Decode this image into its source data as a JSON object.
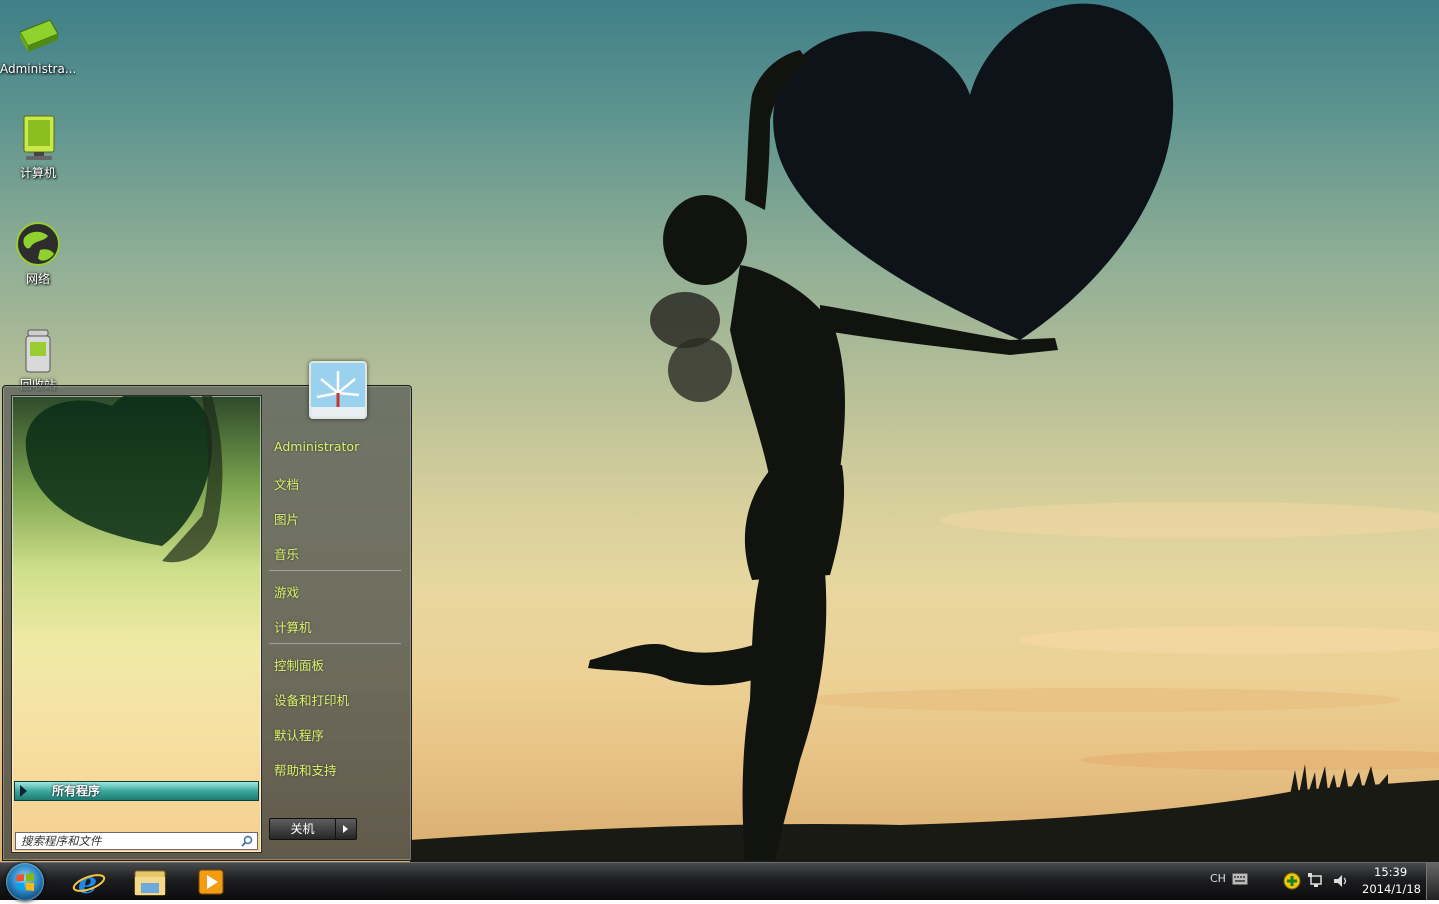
{
  "desktop": {
    "icons": [
      {
        "label": "Administra...",
        "icon": "folder-icon"
      },
      {
        "label": "计算机",
        "icon": "computer-icon"
      },
      {
        "label": "网络",
        "icon": "network-globe-icon"
      },
      {
        "label": "回收站",
        "icon": "recycle-bin-icon"
      }
    ]
  },
  "start_menu": {
    "all_programs_label": "所有程序",
    "search_placeholder": "搜索程序和文件",
    "user_picture_icon": "user-picture-icon",
    "right_items": [
      {
        "label": "Administrator"
      },
      {
        "label": "文档"
      },
      {
        "label": "图片"
      },
      {
        "label": "音乐"
      },
      {
        "label": "游戏"
      },
      {
        "label": "计算机"
      },
      {
        "label": "控制面板"
      },
      {
        "label": "设备和打印机"
      },
      {
        "label": "默认程序"
      },
      {
        "label": "帮助和支持"
      }
    ],
    "shutdown_label": "关机",
    "accent_color": "#d8f26a"
  },
  "taskbar": {
    "pinned": [
      {
        "icon": "internet-explorer-icon"
      },
      {
        "icon": "file-explorer-icon"
      },
      {
        "icon": "media-player-icon"
      }
    ],
    "tray": {
      "language": "CH",
      "time": "15:39",
      "date": "2014/1/18"
    }
  }
}
